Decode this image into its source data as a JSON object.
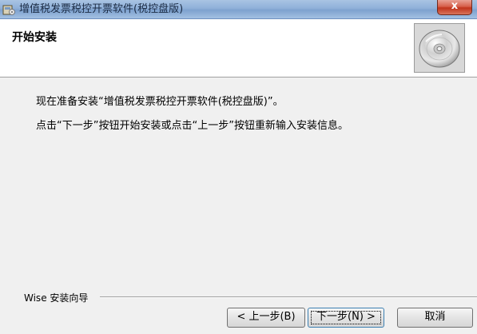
{
  "window": {
    "title": "增值税发票税控开票软件(税控盘版)",
    "close_label": "x"
  },
  "header": {
    "title": "开始安装"
  },
  "body": {
    "line1": "现在准备安装“增值税发票税控开票软件(税控盘版)”。",
    "line2": "点击“下一步”按钮开始安装或点击“上一步”按钮重新输入安装信息。"
  },
  "footer": {
    "wizard_label": "Wise 安装向导",
    "back_button": "< 上一步(B)",
    "next_button": "下一步(N) >",
    "cancel_button": "取消"
  },
  "icons": {
    "app": "installer-app-icon",
    "header": "cd-disc-icon"
  }
}
